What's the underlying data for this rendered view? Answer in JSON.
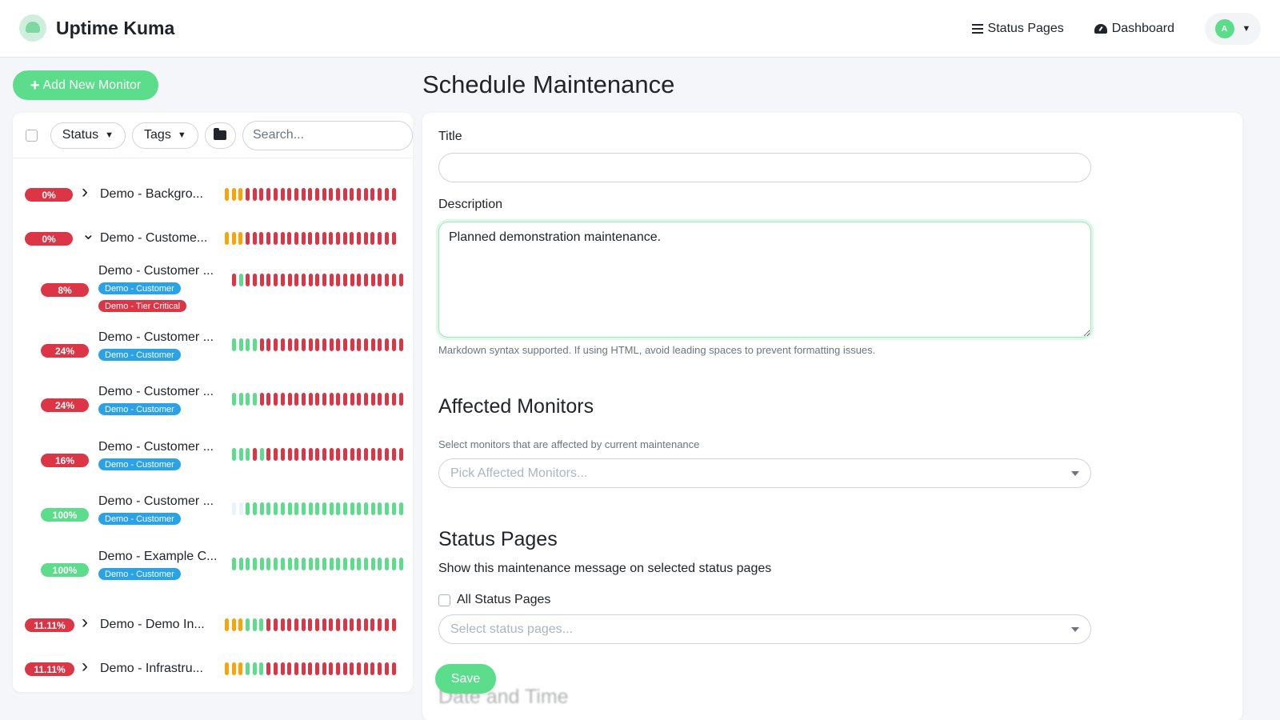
{
  "header": {
    "app_name": "Uptime Kuma",
    "nav": {
      "status_pages": "Status Pages",
      "dashboard": "Dashboard"
    },
    "avatar_initial": "A"
  },
  "sidebar": {
    "add_button": "Add New Monitor",
    "filters": {
      "status": "Status",
      "tags": "Tags"
    },
    "search_placeholder": "Search...",
    "monitors": [
      {
        "uptime": "0%",
        "status": "down",
        "name": "Demo - Backgro...",
        "group": "collapsed",
        "tags": [],
        "beats": "PPPDDDDDDDDDDDDDDDDDDDDDD"
      },
      {
        "uptime": "0%",
        "status": "down",
        "name": "Demo - Custome...",
        "group": "expanded",
        "tags": [],
        "beats": "PPPDDDDDDDDDDDDDDDDDDDDDD"
      },
      {
        "uptime": "8%",
        "status": "down",
        "name": "Demo - Customer ...",
        "tags": [
          "Demo - Customer",
          "Demo - Tier Critical"
        ],
        "beats": "DUDDDDDDDDDDDDDDDDDDDDDDD"
      },
      {
        "uptime": "24%",
        "status": "down",
        "name": "Demo - Customer ...",
        "tags": [
          "Demo - Customer"
        ],
        "beats": "UUUUDDDDDDDDDDDDDDDDDDDDD"
      },
      {
        "uptime": "24%",
        "status": "down",
        "name": "Demo - Customer ...",
        "tags": [
          "Demo - Customer"
        ],
        "beats": "UUUUDDDDDDDDDDDDDDDDDDDDD"
      },
      {
        "uptime": "16%",
        "status": "down",
        "name": "Demo - Customer ...",
        "tags": [
          "Demo - Customer"
        ],
        "beats": "UUUDUDDDDDDDDDDDDDDDDDDDD"
      },
      {
        "uptime": "100%",
        "status": "up",
        "name": "Demo - Customer ...",
        "tags": [
          "Demo - Customer"
        ],
        "beats": "EEUUUUUUUUUUUUUUUUUUUUUUU"
      },
      {
        "uptime": "100%",
        "status": "up",
        "name": "Demo - Example C...",
        "tags": [
          "Demo - Customer"
        ],
        "beats": "UUUUUUUUUUUUUUUUUUUUUUUUU"
      },
      {
        "uptime": "11.11%",
        "status": "down",
        "name": "Demo - Demo In...",
        "group": "collapsed",
        "tags": [],
        "beats": "PPPUUUDDDDDDDDDDDDDDDDDDD"
      },
      {
        "uptime": "11.11%",
        "status": "down",
        "name": "Demo - Infrastru...",
        "group": "collapsed",
        "tags": [],
        "beats": "PPPUUUDDDDDDDDDDDDDDDDDDD"
      }
    ]
  },
  "main": {
    "page_title": "Schedule Maintenance",
    "title_label": "Title",
    "title_value": "",
    "description_label": "Description",
    "description_value": "Planned demonstration maintenance.",
    "markdown_hint": "Markdown syntax supported. If using HTML, avoid leading spaces to prevent formatting issues.",
    "affected_heading": "Affected Monitors",
    "affected_hint": "Select monitors that are affected by current maintenance",
    "affected_placeholder": "Pick Affected Monitors...",
    "status_pages_heading": "Status Pages",
    "status_pages_desc": "Show this maintenance message on selected status pages",
    "all_status_pages": "All Status Pages",
    "status_pages_placeholder": "Select status pages...",
    "save_button": "Save",
    "date_time_heading": "Date and Time"
  },
  "colors": {
    "primary": "#5cdd8b",
    "danger": "#dc3545",
    "pending": "#f8a306",
    "tag_blue": "#2aa2e8"
  }
}
